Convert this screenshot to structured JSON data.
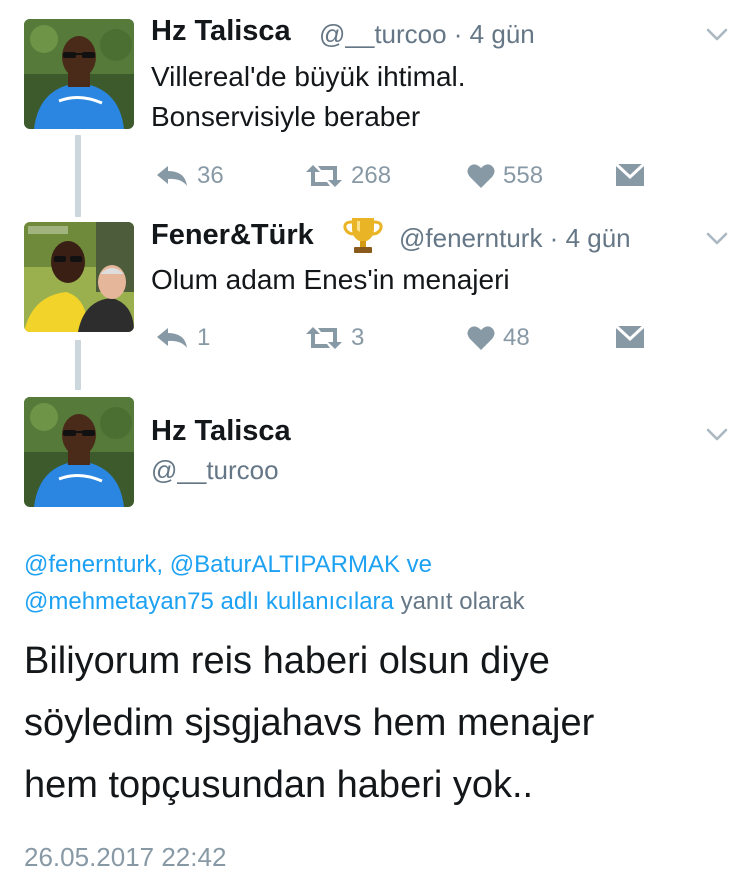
{
  "tweets": [
    {
      "name": "Hz Talisca",
      "meta": "@__turcoo · 4 gün",
      "lines": [
        "Villereal'de büyük ihtimal.",
        "Bonservisiyle beraber"
      ],
      "reply_count": "36",
      "retweet_count": "268",
      "like_count": "558"
    },
    {
      "name": "Fener&Türk",
      "badge": "🏆",
      "meta": "@fenernturk · 4 gün",
      "lines": [
        "Olum adam Enes'in menajeri"
      ],
      "reply_count": "1",
      "retweet_count": "3",
      "like_count": "48"
    }
  ],
  "main_tweet": {
    "name": "Hz Talisca",
    "handle": "@__turcoo",
    "replying": {
      "mention1": "@fenernturk,",
      "mention2": "@BaturALTIPARMAK",
      "and_word": "ve",
      "mention3": "@mehmetayan75 adlı kullanıcılara",
      "suffix": "yanıt olarak"
    },
    "lines": [
      "Biliyorum reis haberi olsun diye",
      "söyledim sjsgjahavs hem menajer",
      "hem topçusundan haberi yok.."
    ],
    "timestamp": "26.05.2017 22:42"
  },
  "colors": {
    "link": "#1da1f2",
    "secondary": "#657786",
    "icon": "#8899a6",
    "thread_line": "#ccd6dd"
  },
  "icons": [
    "reply-icon",
    "retweet-icon",
    "like-icon",
    "direct-message-icon",
    "chevron-down-icon",
    "trophy-icon"
  ]
}
